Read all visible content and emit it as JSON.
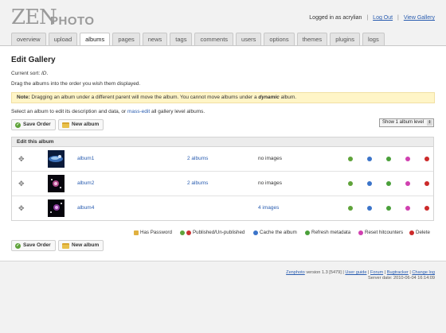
{
  "brand": {
    "logo_zen": "ZEN",
    "logo_photo": "PHOTO"
  },
  "header": {
    "logged_in_text": "Logged in as acrylian",
    "logout": "Log Out",
    "view_gallery": "View Gallery",
    "separator": "|"
  },
  "tabs": [
    {
      "label": "overview",
      "active": false
    },
    {
      "label": "upload",
      "active": false
    },
    {
      "label": "albums",
      "active": true
    },
    {
      "label": "pages",
      "active": false
    },
    {
      "label": "news",
      "active": false
    },
    {
      "label": "tags",
      "active": false
    },
    {
      "label": "comments",
      "active": false
    },
    {
      "label": "users",
      "active": false
    },
    {
      "label": "options",
      "active": false
    },
    {
      "label": "themes",
      "active": false
    },
    {
      "label": "plugins",
      "active": false
    },
    {
      "label": "logs",
      "active": false
    }
  ],
  "page": {
    "title": "Edit Gallery",
    "current_sort_label": "Current sort:",
    "current_sort_value": "ID",
    "drag_instructions": "Drag the albums into the order you wish them displayed.",
    "note_label": "Note:",
    "note_text_before": "Dragging an album under a different parent will move the album. You cannot move albums under a",
    "note_emphasis": "dynamic",
    "note_text_after": "album.",
    "select_text_before": "Select an album to edit its description and data, or",
    "select_link": "mass-edit",
    "select_text_after": "all gallery level albums."
  },
  "buttons": {
    "save_order": "Save Order",
    "new_album": "New album"
  },
  "album_level_select": {
    "selected": "Show 1 album level"
  },
  "table": {
    "header": "Edit this album",
    "rows": [
      {
        "name": "album1",
        "subalbums": "2 albums",
        "images": "no images",
        "images_is_link": false
      },
      {
        "name": "album2",
        "subalbums": "2 albums",
        "images": "no images",
        "images_is_link": false
      },
      {
        "name": "album4",
        "subalbums": "",
        "images": "4 images",
        "images_is_link": true
      }
    ]
  },
  "legend": {
    "has_password": "Has Password",
    "published": "Published/Un-published",
    "cache": "Cache the album",
    "refresh": "Refresh metadata",
    "reset": "Reset hitcounters",
    "delete": "Delete"
  },
  "footer": {
    "product": "Zenphoto",
    "version": "version 1.3 [5479]",
    "user_guide": "User guide",
    "forum": "Forum",
    "bugtracker": "Bugtracker",
    "changelog": "Change log",
    "server_date": "Server date: 2010-06-04 16:14:09"
  },
  "colors": {
    "published": "#5fa33a",
    "unpublished": "#cc3333",
    "cache": "#3b74c9",
    "refresh": "#4aa03a",
    "reset": "#d040b0",
    "delete": "#cc2a2a",
    "link": "#2a5db0",
    "note_bg": "#fff5c7"
  }
}
